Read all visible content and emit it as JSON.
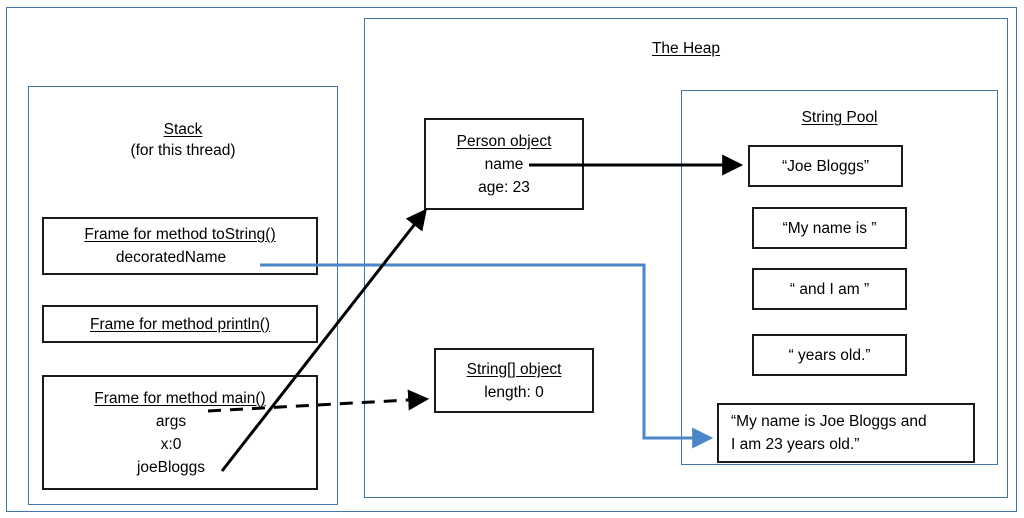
{
  "diagram": {
    "regions": {
      "heap": {
        "title": "The Heap"
      },
      "stack": {
        "title": "Stack",
        "subtitle": "(for this thread)"
      },
      "string_pool": {
        "title": "String Pool"
      }
    },
    "stack_frames": [
      {
        "title": "Frame for method toString()",
        "variables": [
          "decoratedName"
        ]
      },
      {
        "title": "Frame for method println()",
        "variables": []
      },
      {
        "title": "Frame for method main()",
        "variables": [
          "args",
          "x:0",
          "joeBloggs"
        ]
      }
    ],
    "heap_objects": [
      {
        "title": "Person object",
        "fields": [
          "name",
          "age: 23"
        ]
      },
      {
        "title": "String[] object",
        "fields": [
          "length: 0"
        ]
      }
    ],
    "string_pool_entries": [
      "“Joe Bloggs”",
      "“My name is ”",
      "“ and I am ”",
      "“ years old.”"
    ],
    "concatenated_string": {
      "line1": "“My name is Joe Bloggs and",
      "line2": "I am 23 years old.”"
    },
    "colors": {
      "frame_border": "#4674a8",
      "box_border": "#1a1a1a",
      "blue_connector": "#4a86c8",
      "black_connector": "#000000",
      "background": "#ffffff"
    },
    "connectors": [
      {
        "name": "person-name-to-joe-bloggs",
        "style": "solid",
        "color": "#000000"
      },
      {
        "name": "decorated-name-to-concatenated-string",
        "style": "solid",
        "color": "#4a86c8"
      },
      {
        "name": "joe-bloggs-var-to-person-object",
        "style": "solid",
        "color": "#000000"
      },
      {
        "name": "args-to-string-array-object",
        "style": "dashed",
        "color": "#000000"
      }
    ]
  }
}
